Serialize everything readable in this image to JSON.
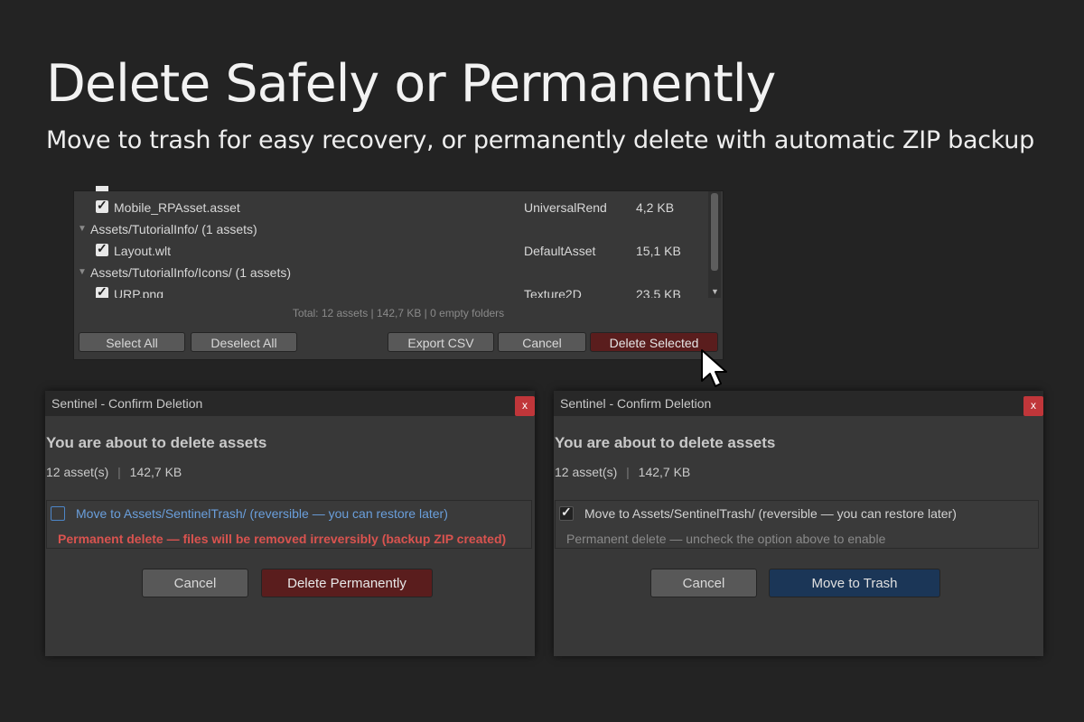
{
  "headline": "Delete Safely or Permanently",
  "subline": "Move to trash for easy recovery, or permanently delete with automatic ZIP backup",
  "panel": {
    "rows": [
      {
        "kind": "asset",
        "name": "Mobile_RPAsset.asset",
        "type": "UniversalRend",
        "size": "4,2 KB"
      },
      {
        "kind": "folder",
        "name": "Assets/TutorialInfo/ (1 assets)"
      },
      {
        "kind": "asset",
        "name": "Layout.wlt",
        "type": "DefaultAsset",
        "size": "15,1 KB"
      },
      {
        "kind": "folder",
        "name": "Assets/TutorialInfo/Icons/ (1 assets)"
      },
      {
        "kind": "asset",
        "name": "URP.png",
        "type": "Texture2D",
        "size": "23,5 KB"
      }
    ],
    "totals": "Total: 12 assets | 142,7 KB | 0 empty folders",
    "buttons": {
      "select_all": "Select All",
      "deselect_all": "Deselect All",
      "export_csv": "Export CSV",
      "cancel": "Cancel",
      "delete_selected": "Delete Selected"
    }
  },
  "dialogs": [
    {
      "title": "Sentinel - Confirm Deletion",
      "close": "x",
      "heading": "You are about to delete assets",
      "count": "12 asset(s)",
      "size": "142,7 KB",
      "option_move": "Move to Assets/SentinelTrash/ (reversible — you can restore later)",
      "option_move_checked": false,
      "option_note": "Permanent delete — files will be removed irreversibly (backup ZIP created)",
      "cancel": "Cancel",
      "confirm": "Delete Permanently"
    },
    {
      "title": "Sentinel - Confirm Deletion",
      "close": "x",
      "heading": "You are about to delete assets",
      "count": "12 asset(s)",
      "size": "142,7 KB",
      "option_move": "Move to Assets/SentinelTrash/ (reversible — you can restore later)",
      "option_move_checked": true,
      "option_note": "Permanent delete — uncheck the option above to enable",
      "cancel": "Cancel",
      "confirm": "Move to Trash"
    }
  ],
  "colors": {
    "background": "#232323",
    "danger_text": "#d9534f",
    "link_blue": "#6a9fdc",
    "muted_text": "#8a8a8a",
    "delete_button": "#5a1d1d",
    "trash_button": "#1b3657",
    "close_button": "#c0363a"
  },
  "icons": {
    "checkbox": "checkmark-icon",
    "folder_toggle": "triangle-down-icon",
    "cursor": "mouse-pointer-icon"
  }
}
